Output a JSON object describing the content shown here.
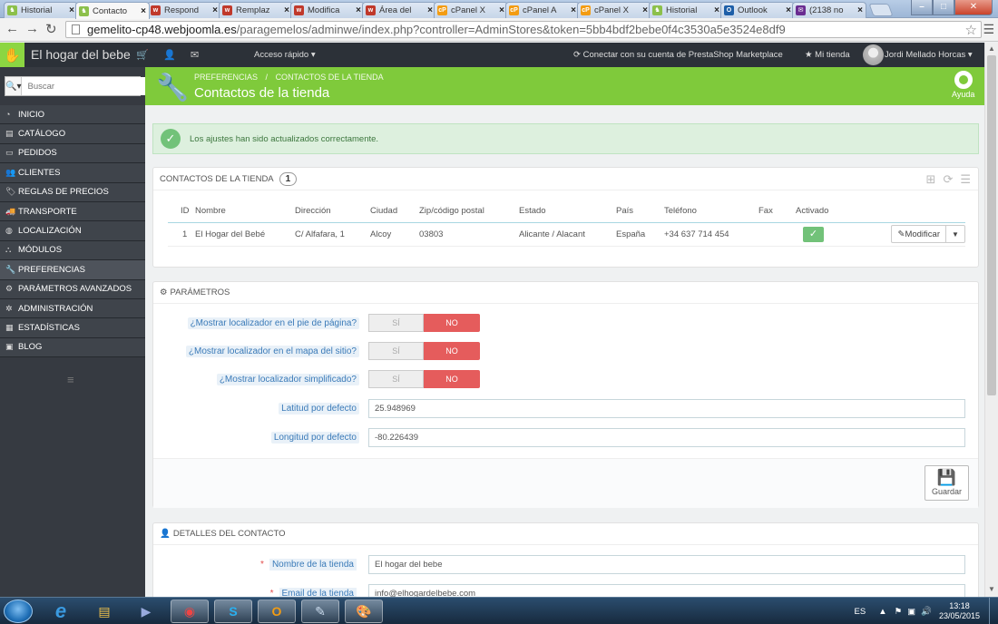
{
  "browser": {
    "tabs": [
      {
        "label": "Historial",
        "favicon_color": "#8cc04b",
        "favicon_glyph": "♞"
      },
      {
        "label": "Contacto",
        "favicon_color": "#8cc04b",
        "favicon_glyph": "♞",
        "active": true
      },
      {
        "label": "Respond",
        "favicon_color": "#c0392b",
        "favicon_glyph": "w"
      },
      {
        "label": "Remplaz",
        "favicon_color": "#c0392b",
        "favicon_glyph": "w"
      },
      {
        "label": "Modifica",
        "favicon_color": "#c0392b",
        "favicon_glyph": "w"
      },
      {
        "label": "Área del",
        "favicon_color": "#c0392b",
        "favicon_glyph": "w"
      },
      {
        "label": "cPanel X",
        "favicon_color": "#f39c12",
        "favicon_glyph": "cP"
      },
      {
        "label": "cPanel A",
        "favicon_color": "#f39c12",
        "favicon_glyph": "cP"
      },
      {
        "label": "cPanel X",
        "favicon_color": "#f39c12",
        "favicon_glyph": "cP"
      },
      {
        "label": "Historial",
        "favicon_color": "#8cc04b",
        "favicon_glyph": "♞"
      },
      {
        "label": "Outlook",
        "favicon_color": "#1e5fa8",
        "favicon_glyph": "O"
      },
      {
        "label": "(2138 no",
        "favicon_color": "#6a2c91",
        "favicon_glyph": "✉"
      }
    ],
    "url_host": "gemelito-cp48.webjoomla.es",
    "url_path": "/paragemelos/adminwe/index.php?controller=AdminStores&token=5bb4bdf2bebe0f4c3530a5e3524e8df9"
  },
  "header": {
    "shop_name": "El hogar del bebe",
    "quick_access": "Acceso rápido",
    "connect": "Conectar con su cuenta de PrestaShop Marketplace",
    "my_store": "Mi tienda",
    "user": "Jordi Mellado Horcas"
  },
  "search": {
    "placeholder": "Buscar"
  },
  "sidebar": {
    "items": [
      {
        "label": "Inicio",
        "icon": "dashboard-icon"
      },
      {
        "label": "Catálogo",
        "icon": "catalog-icon"
      },
      {
        "label": "Pedidos",
        "icon": "orders-icon"
      },
      {
        "label": "Clientes",
        "icon": "customers-icon"
      },
      {
        "label": "Reglas de precios",
        "icon": "price-rules-icon"
      },
      {
        "label": "Transporte",
        "icon": "shipping-icon"
      },
      {
        "label": "Localización",
        "icon": "localization-icon"
      },
      {
        "label": "Módulos",
        "icon": "modules-icon"
      },
      {
        "label": "Preferencias",
        "icon": "wrench-icon",
        "active": true
      },
      {
        "label": "Parámetros avanzados",
        "icon": "cogs-icon"
      },
      {
        "label": "Administración",
        "icon": "gear-icon"
      },
      {
        "label": "Estadísticas",
        "icon": "stats-icon"
      },
      {
        "label": "Blog",
        "icon": "blog-icon"
      }
    ]
  },
  "toolbar": {
    "breadcrumb_1": "Preferencias",
    "breadcrumb_2": "Contactos de la tienda",
    "title": "Contactos de la tienda",
    "help": "Ayuda"
  },
  "alert": {
    "message": "Los ajustes han sido actualizados correctamente."
  },
  "contacts": {
    "title": "Contactos de la tienda",
    "count": "1",
    "columns": [
      "ID",
      "Nombre",
      "Dirección",
      "Ciudad",
      "Zip/código postal",
      "Estado",
      "País",
      "Teléfono",
      "Fax",
      "Activado"
    ],
    "rows": [
      {
        "id": "1",
        "name": "El Hogar del Bebé",
        "address": "C/ Alfafara, 1",
        "city": "Alcoy",
        "zip": "03803",
        "state": "Alicante / Alacant",
        "country": "España",
        "phone": "+34 637 714 454",
        "fax": "",
        "edit_label": "Modificar"
      }
    ]
  },
  "params": {
    "title": "Parámetros",
    "yes_label": "SÍ",
    "no_label": "NO",
    "footer_map_label": "¿Mostrar localizador en el pie de página?",
    "sitemap_label": "¿Mostrar localizador en el mapa del sitio?",
    "simplified_label": "¿Mostrar localizador simplificado?",
    "latitude_label": "Latitud por defecto",
    "latitude_value": "25.948969",
    "longitude_label": "Longitud por defecto",
    "longitude_value": "-80.226439",
    "save_label": "Guardar"
  },
  "details": {
    "title": "Detalles del contacto",
    "store_name_label": "Nombre de la tienda",
    "store_name_value": "El hogar del bebe",
    "email_label": "Email de la tienda",
    "email_value": "info@elhogardelbebe.com"
  },
  "taskbar": {
    "lang": "ES",
    "time": "13:18",
    "date": "23/05/2015"
  },
  "colors": {
    "accent": "#7fca3b",
    "sidebar": "#363a41",
    "no_switch": "#e55c5c",
    "success": "#72c279"
  }
}
